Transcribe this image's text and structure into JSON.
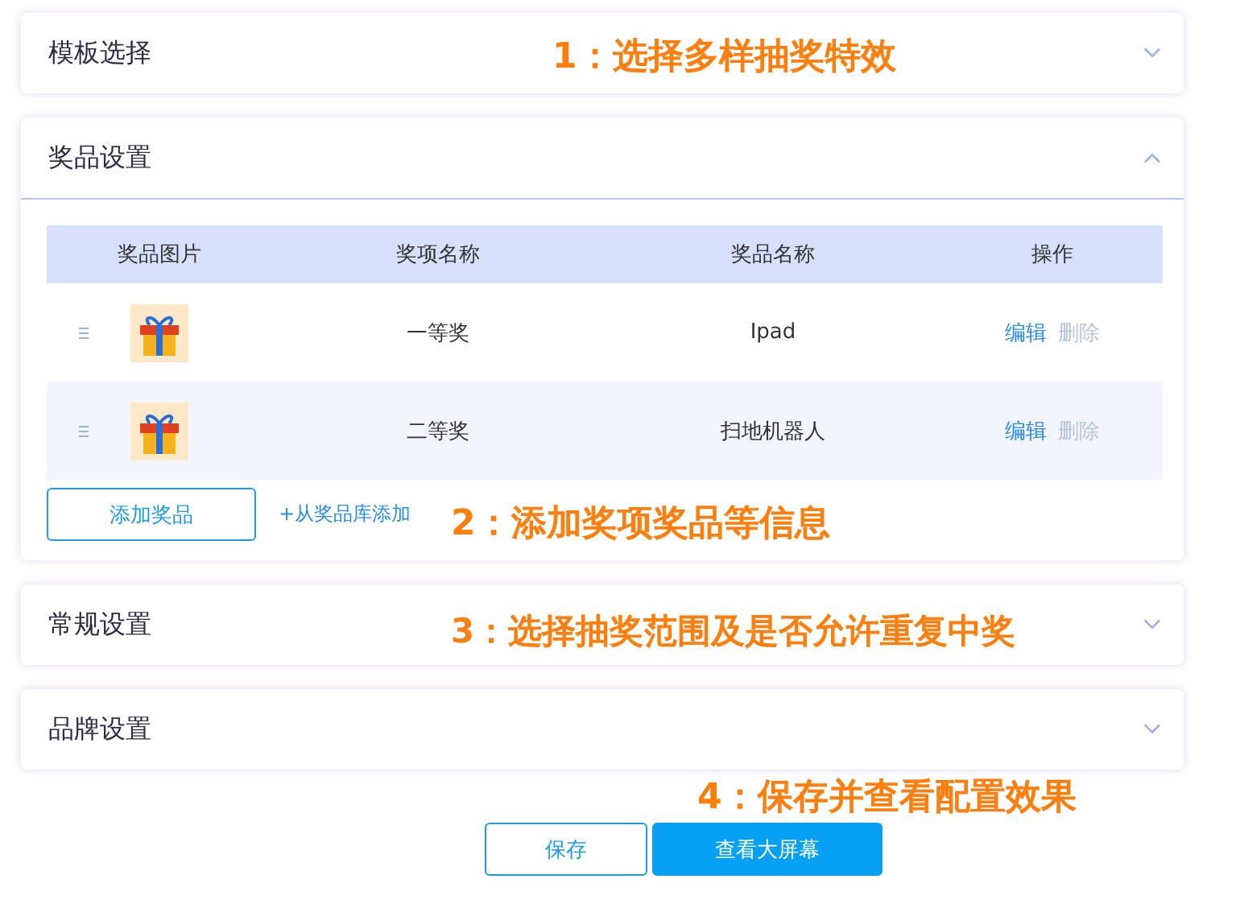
{
  "panels": [
    {
      "title": "模板选择",
      "expanded": false
    },
    {
      "title": "奖品设置",
      "expanded": true
    },
    {
      "title": "常规设置",
      "expanded": false
    },
    {
      "title": "品牌设置",
      "expanded": false
    }
  ],
  "prize_table": {
    "columns": [
      "奖品图片",
      "奖项名称",
      "奖品名称",
      "操作"
    ],
    "rows": [
      {
        "award": "一等奖",
        "prize": "Ipad",
        "actions": [
          {
            "label": "编辑",
            "disabled": false
          },
          {
            "label": "删除",
            "disabled": true
          }
        ]
      },
      {
        "award": "二等奖",
        "prize": "扫地机器人",
        "actions": [
          {
            "label": "编辑",
            "disabled": false
          },
          {
            "label": "删除",
            "disabled": true
          }
        ]
      }
    ],
    "add_button": "添加奖品",
    "library_link": "+从奖品库添加"
  },
  "footer_buttons": [
    {
      "label": "保存",
      "kind": "outline"
    },
    {
      "label": "查看大屏幕",
      "kind": "primary"
    }
  ],
  "annotations": [
    "1：选择多样抽奖特效",
    "2：添加奖项奖品等信息",
    "3：选择抽奖范围及是否允许重复中奖",
    "4：保存并查看配置效果"
  ]
}
